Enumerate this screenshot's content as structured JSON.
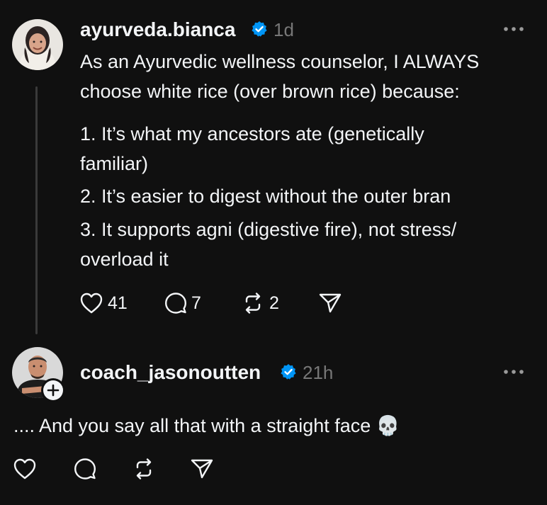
{
  "post": {
    "username": "ayurveda.bianca",
    "time": "1d",
    "lines": [
      "As an Ayurvedic wellness counselor, I ALWAYS",
      "choose white rice (over brown rice) because:",
      "1. It’s what my ancestors ate (genetically",
      "familiar)",
      "2. It’s easier to digest without the outer bran",
      "3. It supports agni (digestive fire), not stress/",
      "overload it"
    ],
    "likes": "41",
    "comments": "7",
    "reposts": "2"
  },
  "reply": {
    "username": "coach_jasonoutten",
    "time": "21h",
    "text": ".... And you say all that with a straight face 💀"
  },
  "colors": {
    "background": "#101010",
    "text": "#f3f5f7",
    "muted": "#777777",
    "verified": "#0095f6"
  },
  "icons": [
    "verified-badge-icon",
    "more-icon",
    "heart-icon",
    "comment-icon",
    "repost-icon",
    "share-icon",
    "plus-icon"
  ]
}
